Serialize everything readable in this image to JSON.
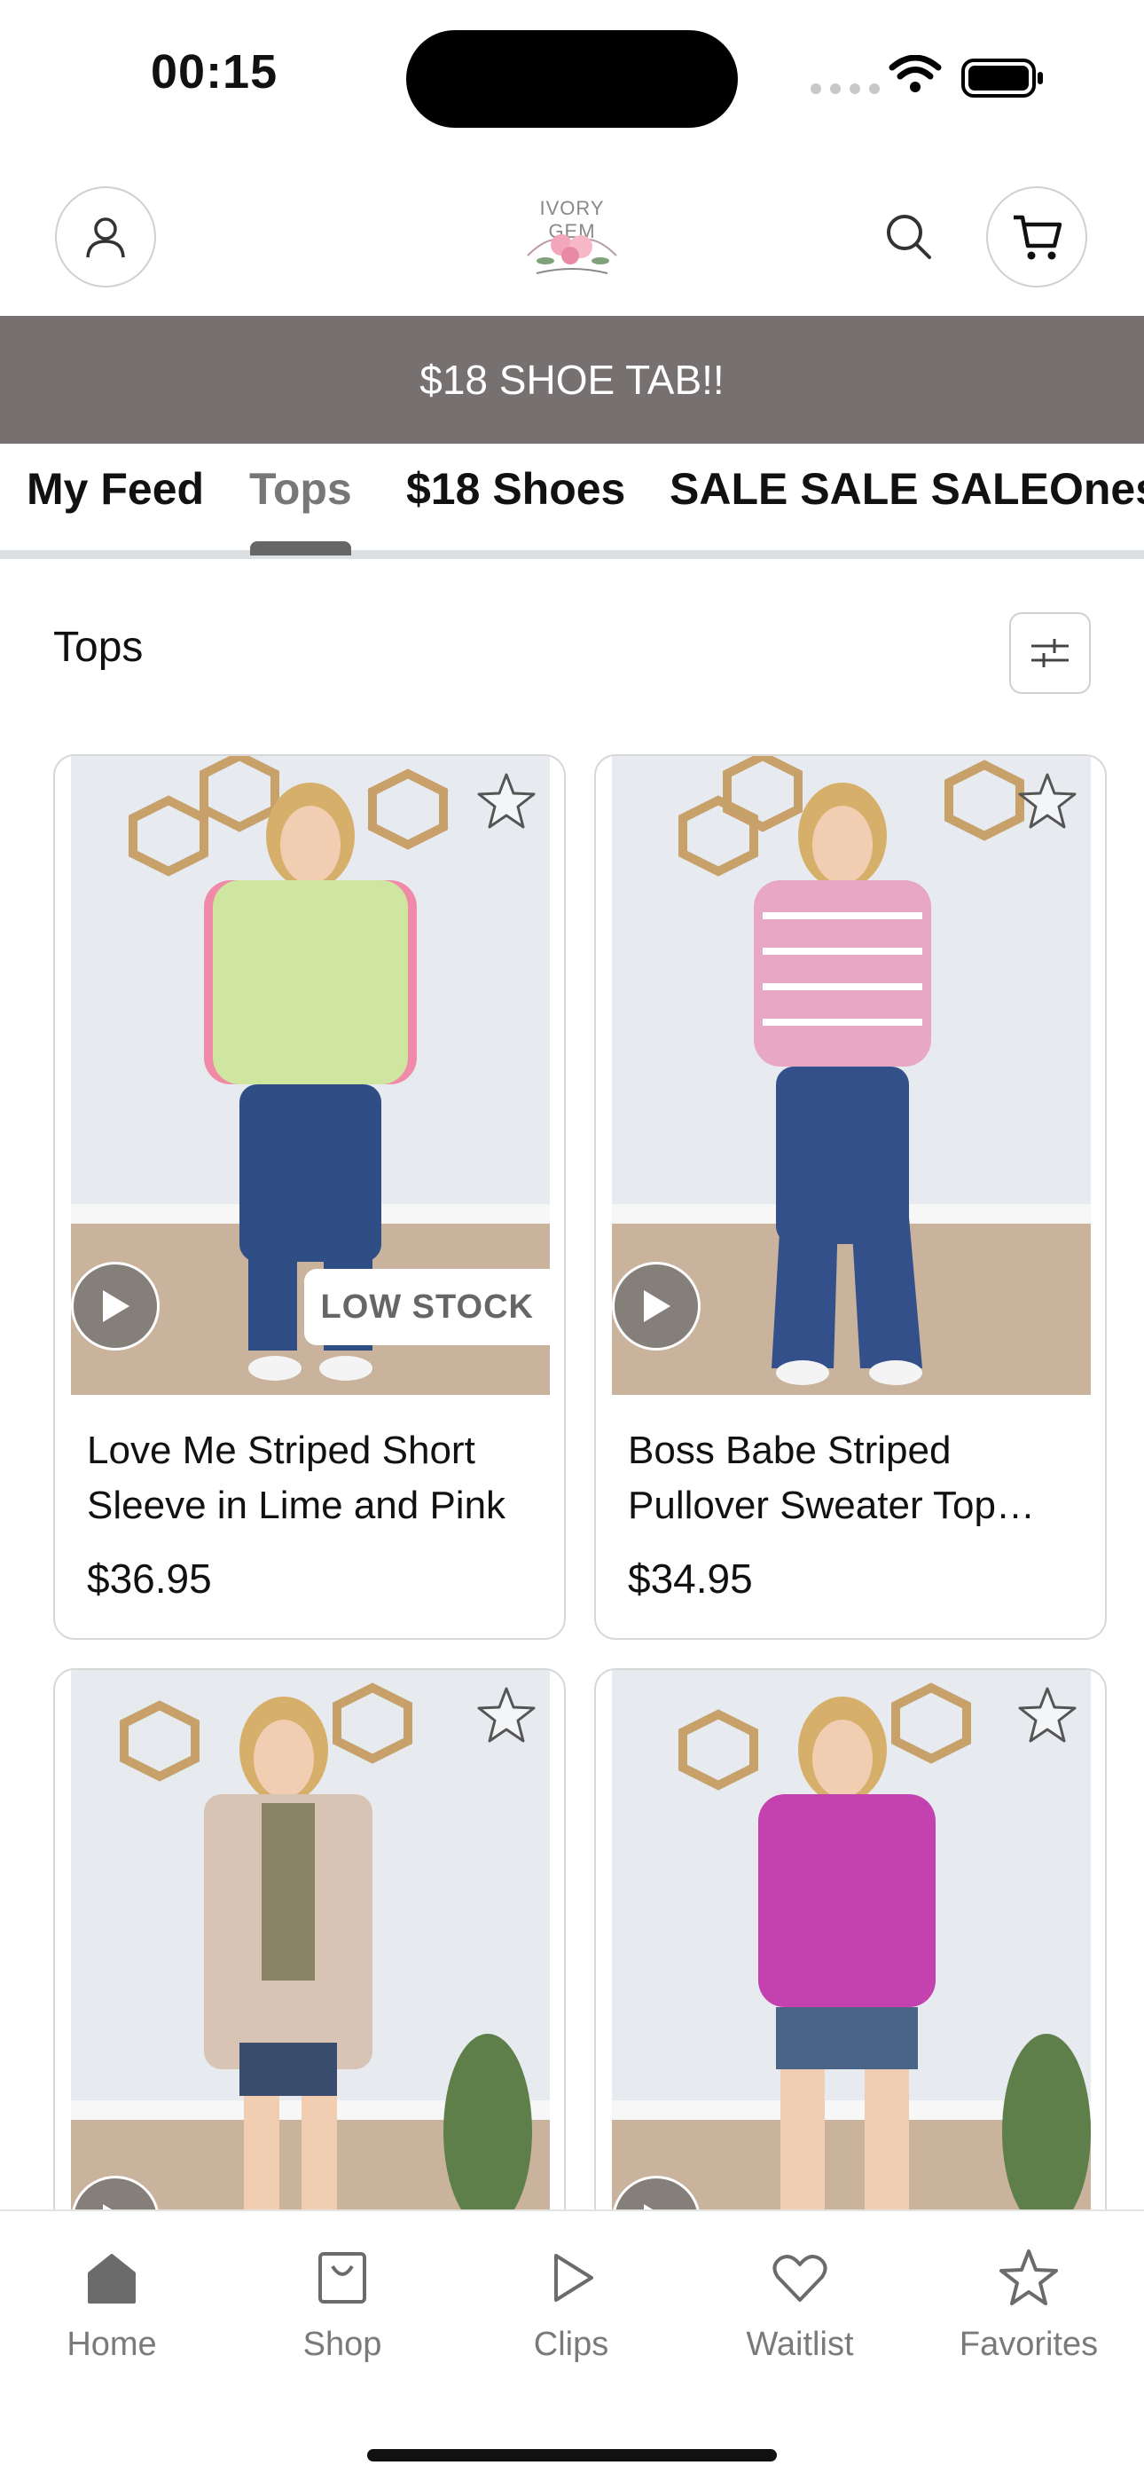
{
  "status_bar": {
    "time": "00:15"
  },
  "header": {
    "logo_text": "IVORY GEM",
    "account_icon": "person-icon",
    "search_icon": "search-icon",
    "cart_icon": "cart-icon"
  },
  "banner": {
    "text": "$18 SHOE TAB!!"
  },
  "tabs": [
    {
      "label": "My Feed"
    },
    {
      "label": "Tops"
    },
    {
      "label": "$18 Shoes"
    },
    {
      "label": "SALE SALE SALE"
    },
    {
      "label": "Ones"
    }
  ],
  "active_tab": "Tops",
  "section": {
    "title": "Tops"
  },
  "products": [
    {
      "name": "Love Me Striped Short Sleeve in Lime and Pink",
      "price": "$36.95",
      "badge": "LOW STOCK",
      "top_color": "#cfe6a0",
      "accent": "#f08aa8"
    },
    {
      "name": "Boss Babe Striped Pullover Sweater Top…",
      "price": "$34.95",
      "badge": "",
      "top_color": "#e8a8c4",
      "accent": "#ffffff"
    },
    {
      "name": "",
      "price": "",
      "badge": "",
      "top_color": "#d8c4b4",
      "accent": "#9a8a70"
    },
    {
      "name": "",
      "price": "",
      "badge": "",
      "top_color": "#c442b0",
      "accent": "#6f7f4e"
    }
  ],
  "bottom_nav": [
    {
      "label": "Home",
      "icon": "home-icon"
    },
    {
      "label": "Shop",
      "icon": "shopping-bag-icon"
    },
    {
      "label": "Clips",
      "icon": "play-icon"
    },
    {
      "label": "Waitlist",
      "icon": "heart-icon"
    },
    {
      "label": "Favorites",
      "icon": "star-icon"
    }
  ],
  "colors": {
    "banner_bg": "#767070",
    "active_tab": "#777777",
    "text": "#111111"
  }
}
